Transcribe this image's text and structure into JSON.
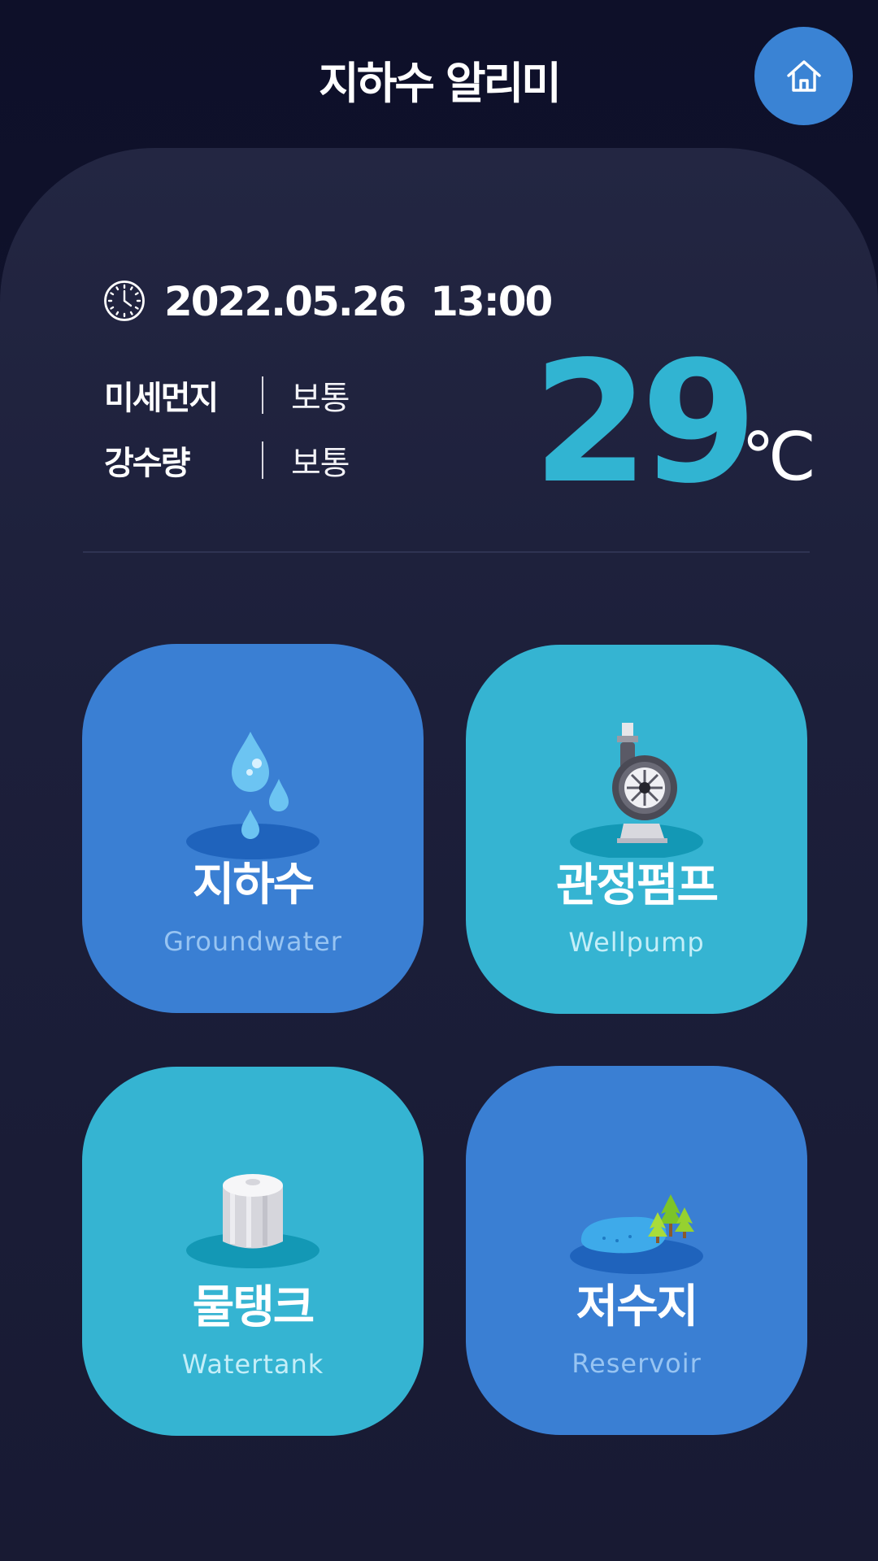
{
  "header": {
    "title": "지하수 알리미",
    "home_icon": "home-icon"
  },
  "status": {
    "clock_icon": "clock-icon",
    "date": "2022.05.26",
    "time": "13:00",
    "rows": [
      {
        "label": "미세먼지",
        "value": "보통"
      },
      {
        "label": "강수량",
        "value": "보통"
      }
    ],
    "temperature": "29",
    "temperature_unit": "℃"
  },
  "menu": {
    "tiles": [
      {
        "title": "지하수",
        "subtitle": "Groundwater",
        "icon": "water-drop-icon",
        "color": "#3a7fd3"
      },
      {
        "title": "관정펌프",
        "subtitle": "Wellpump",
        "icon": "pump-icon",
        "color": "#35b4d2"
      },
      {
        "title": "물탱크",
        "subtitle": "Watertank",
        "icon": "water-tank-icon",
        "color": "#35b4d2"
      },
      {
        "title": "저수지",
        "subtitle": "Reservoir",
        "icon": "reservoir-icon",
        "color": "#3a7fd3"
      }
    ]
  },
  "colors": {
    "background": "#0e1029",
    "panel": "#232642",
    "accent_blue": "#3a7fd3",
    "accent_teal": "#35b4d2",
    "temperature": "#31b4d2"
  }
}
